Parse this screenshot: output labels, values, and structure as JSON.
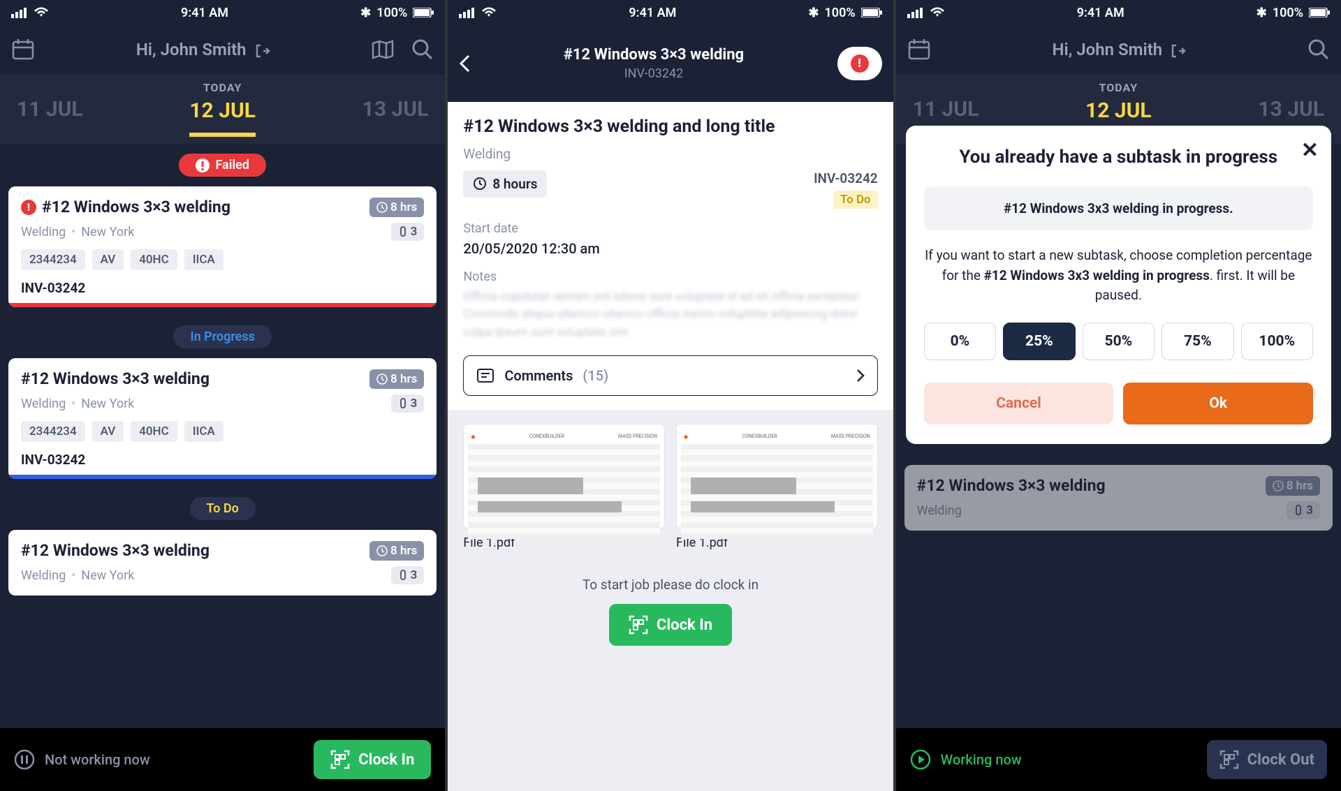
{
  "status_bar": {
    "time": "9:41 AM",
    "battery": "100%"
  },
  "screen1": {
    "greeting": "Hi, John Smith",
    "dates": {
      "today_label": "TODAY",
      "prev": "11 JUL",
      "current": "12 JUL",
      "next": "13 JUL"
    },
    "sections": {
      "failed": "Failed",
      "in_progress": "In Progress",
      "to_do": "To Do"
    },
    "tasks": [
      {
        "title": "#12 Windows 3×3 welding",
        "hours": "8 hrs",
        "category": "Welding",
        "location": "New York",
        "attachments": "3",
        "tags": [
          "2344234",
          "AV",
          "40HC",
          "IICA"
        ],
        "inv": "INV-03242"
      },
      {
        "title": "#12 Windows 3×3 welding",
        "hours": "8 hrs",
        "category": "Welding",
        "location": "New York",
        "attachments": "3",
        "tags": [
          "2344234",
          "AV",
          "40HC",
          "IICA"
        ],
        "inv": "INV-03242"
      },
      {
        "title": "#12 Windows 3×3 welding",
        "hours": "8 hrs",
        "category": "Welding",
        "location": "New York",
        "attachments": "3"
      }
    ],
    "footer": {
      "status": "Not working now",
      "button": "Clock In"
    }
  },
  "screen2": {
    "header_title": "#12 Windows 3×3 welding",
    "header_sub": "INV-03242",
    "title": "#12 Windows 3×3 welding and long title",
    "category": "Welding",
    "hours": "8 hours",
    "inv": "INV-03242",
    "status": "To Do",
    "start_label": "Start date",
    "start_value": "20/05/2020 12:30 am",
    "notes_label": "Notes",
    "notes_text": "Officia cupidatat veniam est labore sunt voluptate id ad sit officia excepteur. Commodo aliqua ullamco ullamco officia minim voluptate adipisicing dolor culpa ipsum sunt voluptate sint.",
    "comments_label": "Comments",
    "comments_count": "(15)",
    "files": [
      "File 1.pdf",
      "File 1.pdf"
    ],
    "thumb_brand": "CONEXBUILDER",
    "clock_hint": "To start job please do clock in",
    "clock_button": "Clock In"
  },
  "screen3": {
    "greeting": "Hi, John Smith",
    "dates": {
      "today_label": "TODAY",
      "prev": "11 JUL",
      "current": "12 JUL",
      "next": "13 JUL"
    },
    "modal": {
      "title": "You already have a subtask in progress",
      "info": "#12 Windows 3x3 welding in progress.",
      "text_1": "If you want to start a new subtask, choose completion percentage for the ",
      "text_bold": "#12 Windows 3x3 welding in progress",
      "text_2": ".  first. It will be paused.",
      "percents": [
        "0%",
        "25%",
        "50%",
        "75%",
        "100%"
      ],
      "cancel": "Cancel",
      "ok": "Ok"
    },
    "task": {
      "title": "#12 Windows 3×3 welding",
      "hours": "8 hrs",
      "category": "Welding",
      "attachments": "3"
    },
    "footer": {
      "status": "Working now",
      "button": "Clock Out"
    }
  }
}
